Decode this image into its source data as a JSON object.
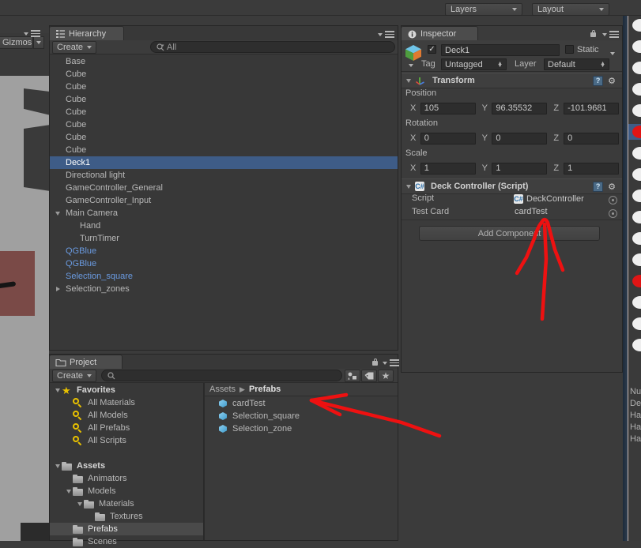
{
  "app": {
    "name": "Unity Editor"
  },
  "top_toolbar": {
    "layers_label": "Layers",
    "layout_label": "Layout"
  },
  "scene_view": {
    "gizmos_label": "Gizmos"
  },
  "hierarchy": {
    "tab_label": "Hierarchy",
    "create_label": "Create",
    "search_value": "All",
    "items": [
      {
        "label": "Base",
        "indent": 0,
        "toggle": "none",
        "style": "normal",
        "selected": false
      },
      {
        "label": "Cube",
        "indent": 0,
        "toggle": "none",
        "style": "normal",
        "selected": false
      },
      {
        "label": "Cube",
        "indent": 0,
        "toggle": "none",
        "style": "normal",
        "selected": false
      },
      {
        "label": "Cube",
        "indent": 0,
        "toggle": "none",
        "style": "normal",
        "selected": false
      },
      {
        "label": "Cube",
        "indent": 0,
        "toggle": "none",
        "style": "normal",
        "selected": false
      },
      {
        "label": "Cube",
        "indent": 0,
        "toggle": "none",
        "style": "normal",
        "selected": false
      },
      {
        "label": "Cube",
        "indent": 0,
        "toggle": "none",
        "style": "normal",
        "selected": false
      },
      {
        "label": "Cube",
        "indent": 0,
        "toggle": "none",
        "style": "normal",
        "selected": false
      },
      {
        "label": "Deck1",
        "indent": 0,
        "toggle": "none",
        "style": "normal",
        "selected": true
      },
      {
        "label": "Directional light",
        "indent": 0,
        "toggle": "none",
        "style": "normal",
        "selected": false
      },
      {
        "label": "GameController_General",
        "indent": 0,
        "toggle": "none",
        "style": "normal",
        "selected": false
      },
      {
        "label": "GameController_Input",
        "indent": 0,
        "toggle": "none",
        "style": "normal",
        "selected": false
      },
      {
        "label": "Main Camera",
        "indent": 0,
        "toggle": "open",
        "style": "normal",
        "selected": false
      },
      {
        "label": "Hand",
        "indent": 1,
        "toggle": "none",
        "style": "normal",
        "selected": false
      },
      {
        "label": "TurnTimer",
        "indent": 1,
        "toggle": "none",
        "style": "normal",
        "selected": false
      },
      {
        "label": "QGBlue",
        "indent": 0,
        "toggle": "none",
        "style": "prefab",
        "selected": false
      },
      {
        "label": "QGBlue",
        "indent": 0,
        "toggle": "none",
        "style": "prefab",
        "selected": false
      },
      {
        "label": "Selection_square",
        "indent": 0,
        "toggle": "none",
        "style": "prefab",
        "selected": false
      },
      {
        "label": "Selection_zones",
        "indent": 0,
        "toggle": "closed",
        "style": "normal",
        "selected": false
      }
    ]
  },
  "inspector": {
    "tab_label": "Inspector",
    "object_name": "Deck1",
    "enabled": true,
    "static_label": "Static",
    "static_checked": false,
    "tag_label": "Tag",
    "tag_value": "Untagged",
    "layer_label": "Layer",
    "layer_value": "Default",
    "transform": {
      "title": "Transform",
      "position_label": "Position",
      "rotation_label": "Rotation",
      "scale_label": "Scale",
      "position": {
        "x": "105",
        "y": "96.35532",
        "z": "-101.9681"
      },
      "rotation": {
        "x": "0",
        "y": "0",
        "z": "0"
      },
      "scale": {
        "x": "1",
        "y": "1",
        "z": "1"
      },
      "axis_x": "X",
      "axis_y": "Y",
      "axis_z": "Z"
    },
    "deck_controller": {
      "title": "Deck Controller (Script)",
      "fields": [
        {
          "label": "Script",
          "value": "DeckController",
          "has_icon": true
        },
        {
          "label": "Test Card",
          "value": "cardTest",
          "has_icon": false
        }
      ]
    },
    "add_component_label": "Add Component"
  },
  "project": {
    "tab_label": "Project",
    "create_label": "Create",
    "search_value": "",
    "tree": [
      {
        "label": "Favorites",
        "indent": 0,
        "toggle": "open",
        "icon": "star",
        "bold": true,
        "selected": false
      },
      {
        "label": "All Materials",
        "indent": 1,
        "toggle": "none",
        "icon": "search",
        "bold": false,
        "selected": false
      },
      {
        "label": "All Models",
        "indent": 1,
        "toggle": "none",
        "icon": "search",
        "bold": false,
        "selected": false
      },
      {
        "label": "All Prefabs",
        "indent": 1,
        "toggle": "none",
        "icon": "search",
        "bold": false,
        "selected": false
      },
      {
        "label": "All Scripts",
        "indent": 1,
        "toggle": "none",
        "icon": "search",
        "bold": false,
        "selected": false
      },
      {
        "label": "",
        "indent": 0,
        "toggle": "none",
        "icon": "none",
        "bold": false,
        "selected": false
      },
      {
        "label": "Assets",
        "indent": 0,
        "toggle": "open",
        "icon": "folder",
        "bold": true,
        "selected": false
      },
      {
        "label": "Animators",
        "indent": 1,
        "toggle": "none",
        "icon": "folder",
        "bold": false,
        "selected": false
      },
      {
        "label": "Models",
        "indent": 1,
        "toggle": "open",
        "icon": "folder",
        "bold": false,
        "selected": false
      },
      {
        "label": "Materials",
        "indent": 2,
        "toggle": "open",
        "icon": "folder",
        "bold": false,
        "selected": false
      },
      {
        "label": "Textures",
        "indent": 3,
        "toggle": "none",
        "icon": "folder",
        "bold": false,
        "selected": false
      },
      {
        "label": "Prefabs",
        "indent": 1,
        "toggle": "none",
        "icon": "folder",
        "bold": false,
        "selected": true
      },
      {
        "label": "Scenes",
        "indent": 1,
        "toggle": "none",
        "icon": "folder",
        "bold": false,
        "selected": false
      }
    ],
    "breadcrumb": [
      "Assets",
      "Prefabs"
    ],
    "assets": [
      {
        "label": "cardTest",
        "icon": "prefab-cube"
      },
      {
        "label": "Selection_square",
        "icon": "prefab-cube"
      },
      {
        "label": "Selection_zone",
        "icon": "prefab-cube"
      }
    ]
  },
  "annotations": {
    "arrow_inspector_target": "cardTest",
    "arrow_project_target": "cardTest",
    "color": "#ee1111"
  },
  "right_strip": {
    "truncated_labels": [
      "Nu",
      "De",
      "Ha",
      "Ha",
      "Ha"
    ]
  },
  "colors": {
    "accent_selection": "#3e5c87",
    "panel_bg": "#383838",
    "window_bg": "#3b3b3b",
    "prefab_blue": "#6a9ae0",
    "annotation_red": "#ee1111"
  }
}
